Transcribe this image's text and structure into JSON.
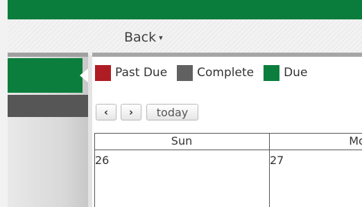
{
  "header": {
    "back_label": "Back",
    "back_caret": "▾"
  },
  "legend": [
    {
      "label": "Past Due",
      "color": "#b01c23"
    },
    {
      "label": "Complete",
      "color": "#616161"
    },
    {
      "label": "Due",
      "color": "#0b7e3d"
    }
  ],
  "nav": {
    "prev": "‹",
    "next": "›",
    "today": "today"
  },
  "calendar": {
    "days": [
      "Sun",
      "Mo"
    ],
    "dates": [
      "26",
      "27"
    ]
  }
}
